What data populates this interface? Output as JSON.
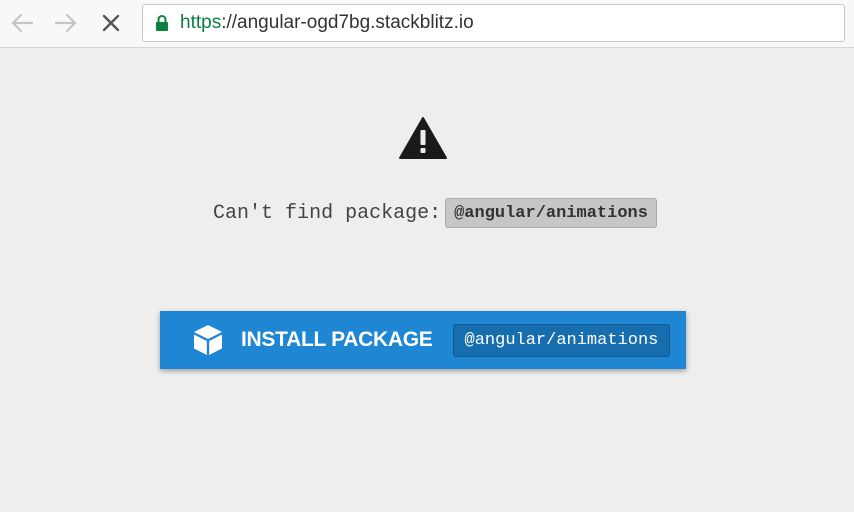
{
  "browser": {
    "back_icon": "arrow-left-icon",
    "forward_icon": "arrow-right-icon",
    "stop_icon": "close-icon",
    "address": {
      "lock_icon": "lock-icon",
      "scheme": "https",
      "separator": "://",
      "host": "angular-ogd7bg.stackblitz.io",
      "secure_color": "#0b8043"
    }
  },
  "error": {
    "icon": "warning-icon",
    "message": "Can't find package:",
    "package_name": "@angular/animations"
  },
  "install_button": {
    "icon": "package-box-icon",
    "label": "INSTALL PACKAGE",
    "package_name": "@angular/animations",
    "color": "#1f86d4"
  }
}
